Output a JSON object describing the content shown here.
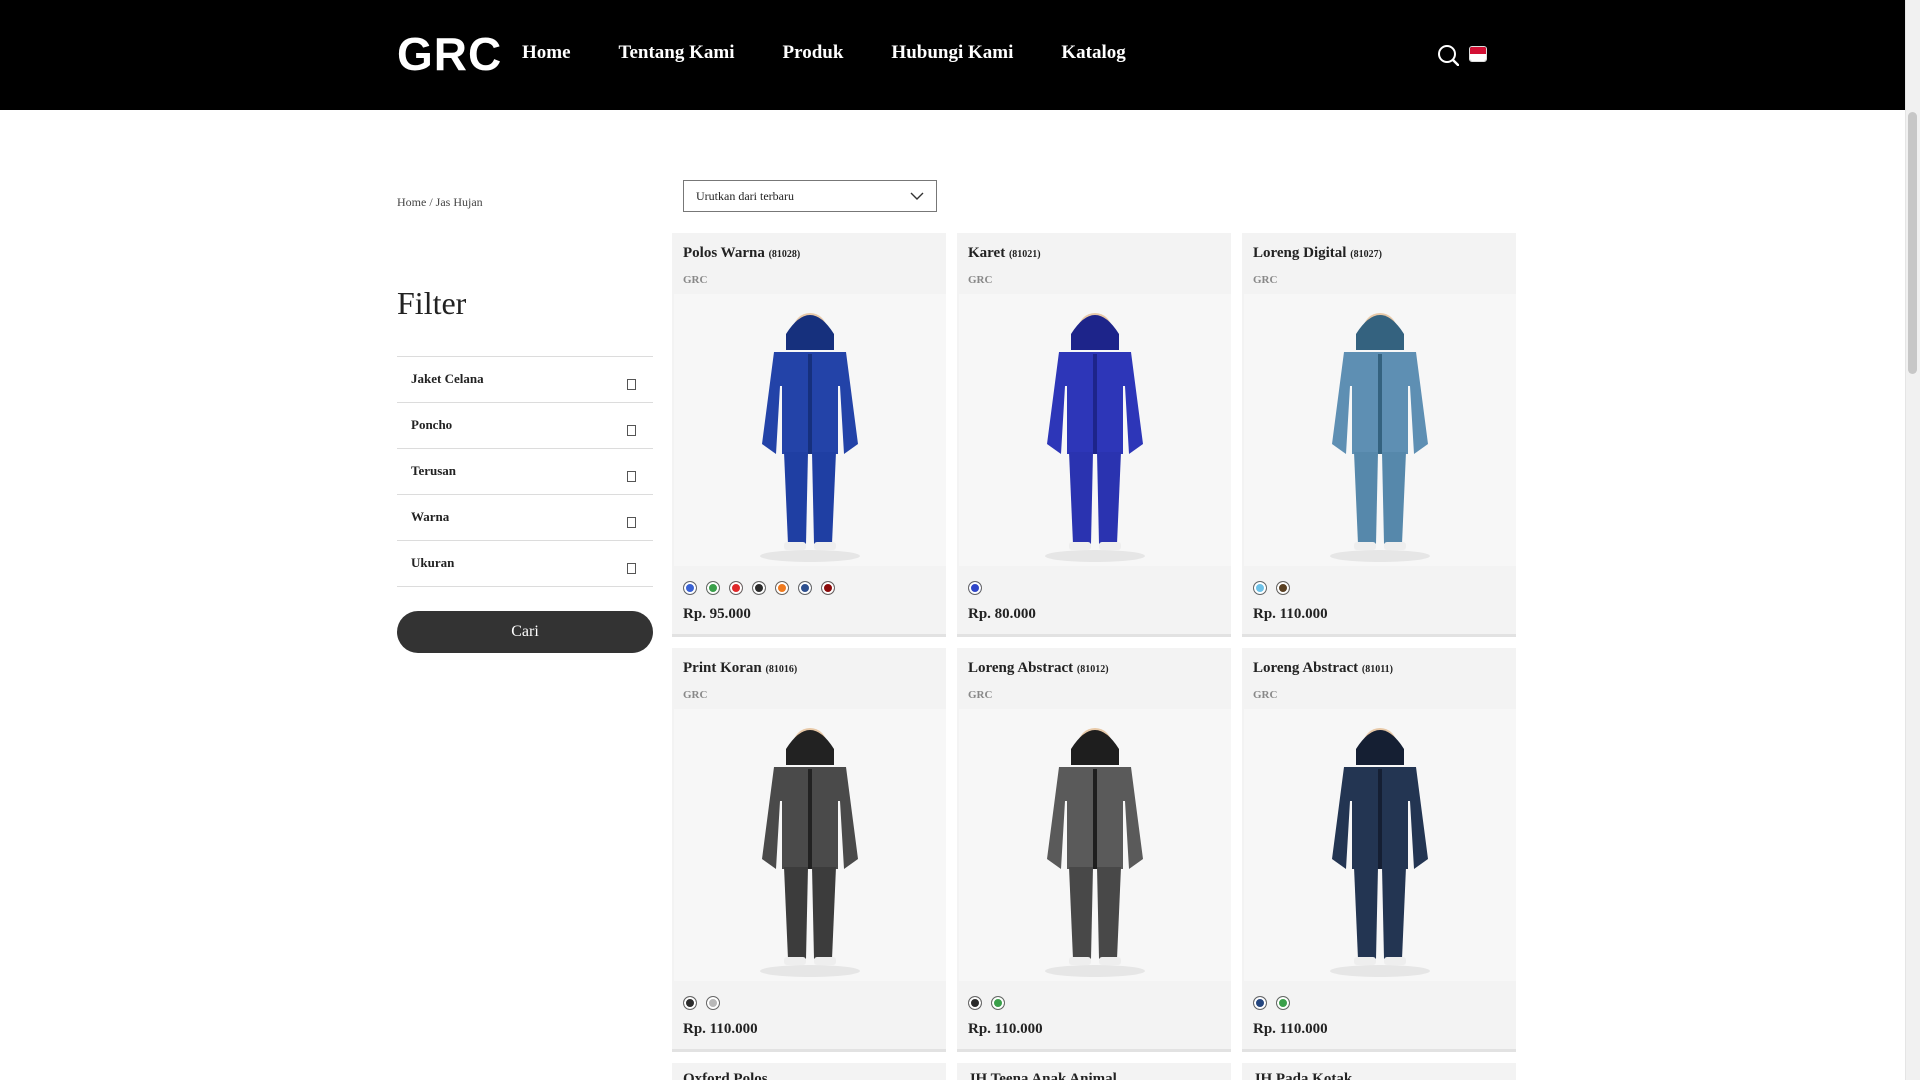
{
  "header": {
    "logo": "GRC",
    "nav": [
      "Home",
      "Tentang Kami",
      "Produk",
      "Hubungi Kami",
      "Katalog"
    ],
    "icons": [
      "search-icon",
      "flag-indonesia-icon"
    ]
  },
  "breadcrumb": "Home / Jas Hujan",
  "filter": {
    "title": "Filter",
    "items": [
      "Jaket Celana",
      "Poncho",
      "Terusan",
      "Warna",
      "Ukuran"
    ],
    "button": "Cari"
  },
  "sort": {
    "selected": "Urutkan dari terbaru"
  },
  "products": [
    {
      "name": "Polos Warna",
      "code": "(81028)",
      "brand": "GRC",
      "price": "Rp. 95.000",
      "swatches": [
        "#3a62d4",
        "#3aa04a",
        "#e0282a",
        "#2b2b2b",
        "#f07a1e",
        "#2d4f8f",
        "#8b0a0a"
      ]
    },
    {
      "name": "Karet",
      "code": "(81021)",
      "brand": "GRC",
      "price": "Rp. 80.000",
      "swatches": [
        "#2f46c9"
      ]
    },
    {
      "name": "Loreng Digital",
      "code": "(81027)",
      "brand": "GRC",
      "price": "Rp. 110.000",
      "swatches": [
        "#6ec2e8",
        "#5a4022"
      ]
    },
    {
      "name": "Print Koran",
      "code": "(81016)",
      "brand": "GRC",
      "price": "Rp. 110.000",
      "swatches": [
        "#2b2b2b",
        "#b8b8b8"
      ]
    },
    {
      "name": "Loreng Abstract",
      "code": "(81012)",
      "brand": "GRC",
      "price": "Rp. 110.000",
      "swatches": [
        "#2b2b2b",
        "#3aa04a"
      ]
    },
    {
      "name": "Loreng Abstract",
      "code": "(81011)",
      "brand": "GRC",
      "price": "Rp. 110.000",
      "swatches": [
        "#24457e",
        "#3aa04a"
      ]
    }
  ],
  "partial_products": [
    "Oxford Polos",
    "JH Teena Anak Animal",
    "JH Pada Kotak"
  ]
}
